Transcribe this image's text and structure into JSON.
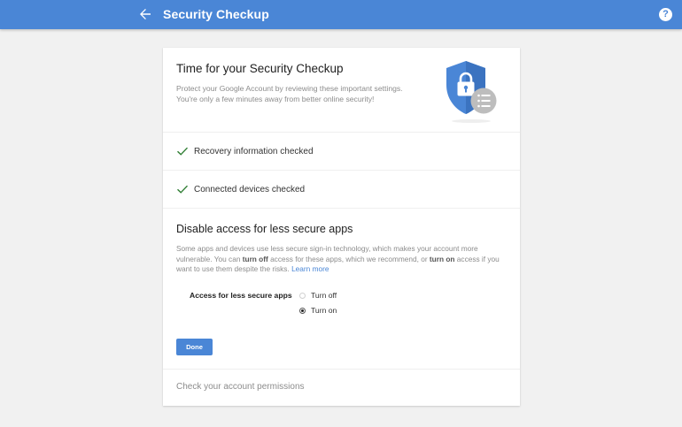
{
  "header": {
    "title": "Security Checkup",
    "back_icon": "arrow-left-icon",
    "help_icon": "help-icon",
    "help_glyph": "?",
    "bar_color": "#4a86d6"
  },
  "intro": {
    "title": "Time for your Security Checkup",
    "description": "Protect your Google Account by reviewing these important settings. You're only a few minutes away from better online security!",
    "illustration_icon": "shield-lock-icon"
  },
  "checks": [
    {
      "label": "Recovery information checked",
      "icon": "checkmark-icon"
    },
    {
      "label": "Connected devices checked",
      "icon": "checkmark-icon"
    }
  ],
  "less_secure_apps": {
    "title": "Disable access for less secure apps",
    "desc_1": "Some apps and devices use less secure sign-in technology, which makes your account more vulnerable. You can ",
    "turn_off_bold": "turn off",
    "desc_2": " access for these apps, which we recommend, or ",
    "turn_on_bold": "turn on",
    "desc_3": " access if you want to use them despite the risks. ",
    "learn_more": "Learn more",
    "setting_label": "Access for less secure apps",
    "options": [
      {
        "label": "Turn off",
        "selected": false
      },
      {
        "label": "Turn on",
        "selected": true
      }
    ],
    "done_label": "Done"
  },
  "footer_link": "Check your account permissions",
  "colors": {
    "accent": "#4a86d6",
    "check": "#2e7d32",
    "muted_text": "#8c8c8c"
  }
}
